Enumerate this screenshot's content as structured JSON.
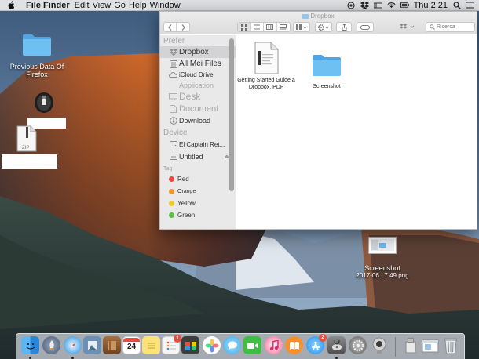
{
  "menubar": {
    "app_name": "File Finder",
    "items": [
      "Edit",
      "View",
      "Go",
      "Help",
      "Window"
    ],
    "clock": "Thu 2 21"
  },
  "desktop": {
    "icons": [
      {
        "label_line1": "Previous Data Of",
        "label_line2": "Firefox",
        "icon": "folder-icon"
      },
      {
        "label": "",
        "icon": "usb-drive-icon"
      },
      {
        "label": "ZIP",
        "icon": "zip-archive-icon"
      },
      {
        "label_line1": "Screenshot",
        "label_line2": "2017-06...7 49.png",
        "icon": "screenshot-thumbnail-icon"
      }
    ]
  },
  "finder": {
    "title": "Dropbox",
    "search_placeholder": "Ricerca",
    "sidebar": {
      "favorites_header": "Prefer",
      "favorites": [
        {
          "label": "Dropbox",
          "icon": "dropbox-icon",
          "selected": true
        },
        {
          "label": "All Mei Files",
          "icon": "all-files-icon"
        },
        {
          "label": "iCloud Drive",
          "icon": "cloud-icon"
        },
        {
          "label": "Application",
          "icon": "applications-icon"
        },
        {
          "label": "Desk",
          "icon": "desktop-icon"
        },
        {
          "label": "Document",
          "icon": "document-icon"
        },
        {
          "label": "Download",
          "icon": "download-icon"
        }
      ],
      "devices_header": "Device",
      "devices": [
        {
          "label": "El Captain Ret...",
          "icon": "hard-drive-icon"
        },
        {
          "label": "Untitled",
          "icon": "disk-icon"
        }
      ],
      "tags_header": "Tag",
      "tags": [
        {
          "label": "Red",
          "color": "#e94b3c"
        },
        {
          "label": "Orange",
          "color": "#f0962d"
        },
        {
          "label": "Yellow",
          "color": "#f2c830"
        },
        {
          "label": "Green",
          "color": "#5bc043"
        }
      ]
    },
    "files": [
      {
        "label_line1": "Getting Started Guide a",
        "label_line2": "Dropbox. PDF",
        "icon": "pdf-file-icon"
      },
      {
        "label_line1": "Screenshot",
        "label_line2": "",
        "icon": "folder-icon"
      }
    ]
  },
  "dock": {
    "items": [
      {
        "name": "finder",
        "color": "#2f8ee8"
      },
      {
        "name": "launchpad",
        "color": "#5a6a80"
      },
      {
        "name": "safari",
        "color": "#1d8ce0"
      },
      {
        "name": "preview",
        "color": "#6b8fb5"
      },
      {
        "name": "notes-book",
        "color": "#8b5a2b"
      },
      {
        "name": "calendar",
        "color": "#ffffff",
        "text": "24"
      },
      {
        "name": "stickies",
        "color": "#fbe27a"
      },
      {
        "name": "reminders",
        "color": "#f5f5f5",
        "badge": "1"
      },
      {
        "name": "photo-booth",
        "color": "#4a4a4a"
      },
      {
        "name": "photos",
        "color": "#ffffff"
      },
      {
        "name": "messages",
        "color": "#5cc0f7"
      },
      {
        "name": "facetime",
        "color": "#3fbe45"
      },
      {
        "name": "itunes",
        "color": "#fb5a8e"
      },
      {
        "name": "ibooks",
        "color": "#f7902c"
      },
      {
        "name": "app-store",
        "color": "#1b8ff0",
        "badge": "2"
      },
      {
        "name": "disk-utility",
        "color": "#6c6c6c"
      },
      {
        "name": "system-preferences",
        "color": "#8a8a8a"
      },
      {
        "name": "webcam",
        "color": "#b0b0b0"
      },
      {
        "name": "removable-drive",
        "color": "#dedede"
      },
      {
        "name": "downloads-stack",
        "color": "#d9e3ee"
      },
      {
        "name": "trash",
        "color": "#c9cdd2"
      }
    ]
  },
  "colors": {
    "sidebar_bg": "#e9e9ea",
    "folder_blue": "#57b2ec",
    "selected_row": "#d3d3d5"
  }
}
